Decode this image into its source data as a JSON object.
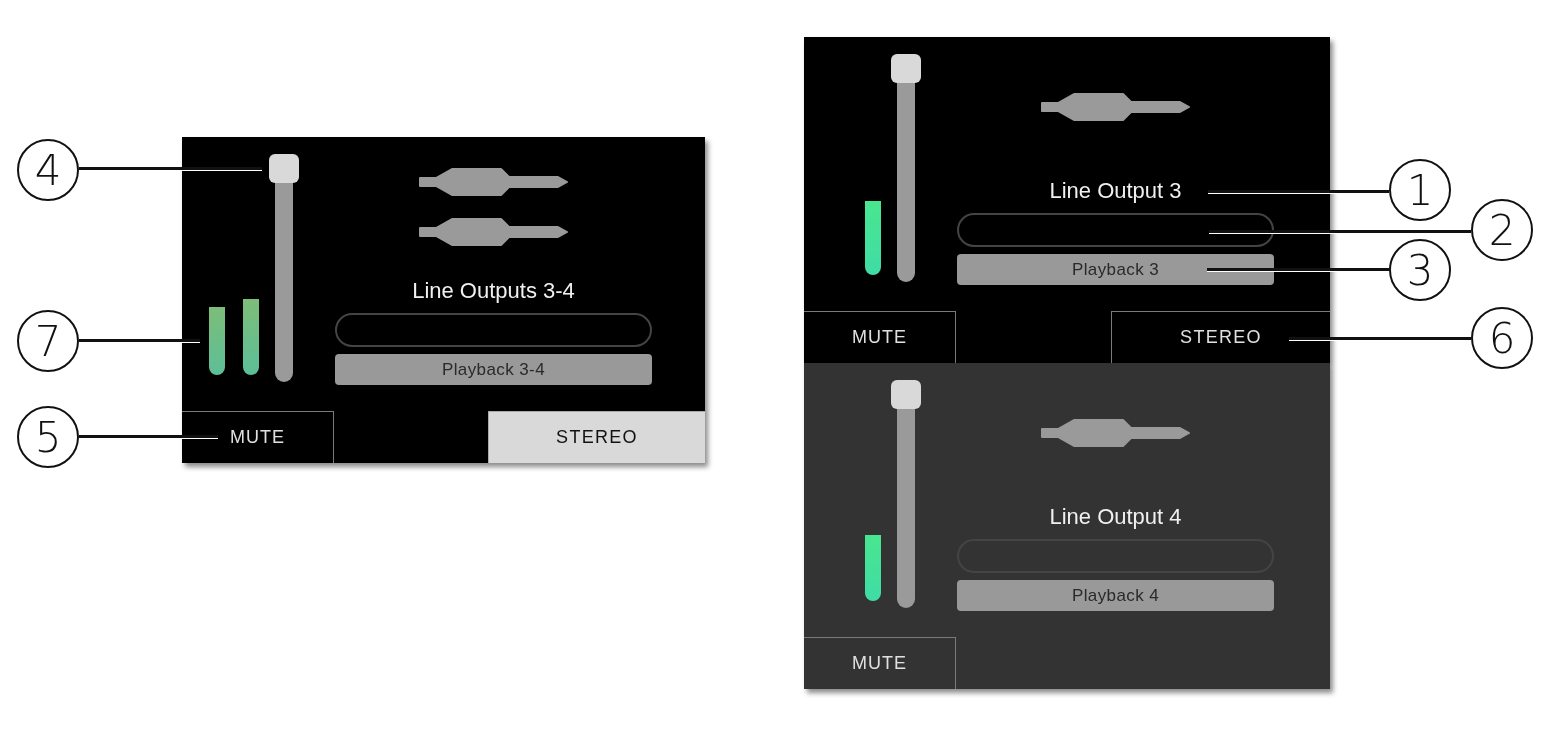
{
  "panels": [
    {
      "strips": [
        {
          "kind": "stereo",
          "selected": false,
          "meters": [
            {
              "level": 0.33
            },
            {
              "level": 0.37
            }
          ],
          "fader": {
            "level": 1
          },
          "title": "Line Outputs 3-4",
          "source": "Playback 3-4",
          "mute": {
            "label": "MUTE",
            "on": false
          },
          "stereo": {
            "label": "STEREO",
            "on": true
          }
        }
      ]
    },
    {
      "strips": [
        {
          "kind": "mono",
          "selected": false,
          "meters": [
            {
              "level": 0.36
            }
          ],
          "fader": {
            "level": 1
          },
          "title": "Line Output 3",
          "source": "Playback 3",
          "mute": {
            "label": "MUTE",
            "on": false
          },
          "stereo": {
            "label": "STEREO",
            "on": false
          }
        },
        {
          "kind": "mono",
          "selected": true,
          "meters": [
            {
              "level": 0.32
            }
          ],
          "fader": {
            "level": 1
          },
          "title": "Line Output 4",
          "source": "Playback 4",
          "mute": {
            "label": "MUTE",
            "on": false
          }
        }
      ]
    }
  ],
  "callouts": [
    {
      "label": "4"
    },
    {
      "label": "7"
    },
    {
      "label": "5"
    },
    {
      "label": "1"
    },
    {
      "label": "2"
    },
    {
      "label": "3"
    },
    {
      "label": "6"
    }
  ]
}
